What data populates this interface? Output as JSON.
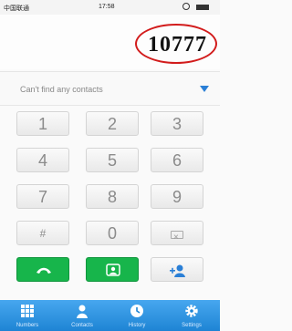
{
  "status": {
    "carrier": "中国联通",
    "time": "17:58"
  },
  "display": {
    "number": "10777"
  },
  "contacts": {
    "message": "Can't find any contacts"
  },
  "keypad": {
    "keys": [
      "1",
      "2",
      "3",
      "4",
      "5",
      "6",
      "7",
      "8",
      "9",
      "#",
      "0"
    ]
  },
  "tabs": [
    "Numbers",
    "Contacts",
    "History",
    "Settings"
  ],
  "colors": {
    "accent": "#1e84d4",
    "call_green": "#17b54b",
    "highlight_red": "#d21c1c"
  }
}
